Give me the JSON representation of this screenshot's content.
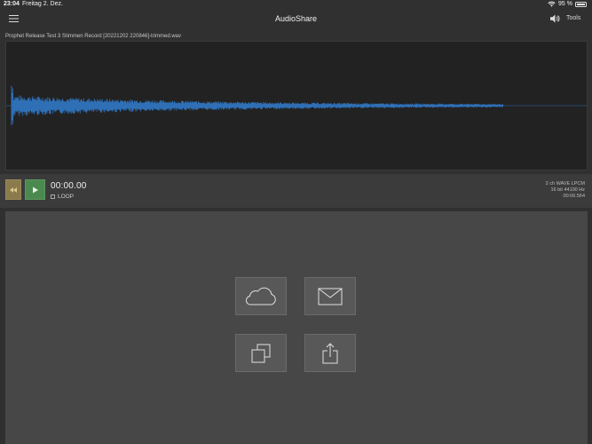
{
  "status_bar": {
    "time": "23:04",
    "date": "Freitag 2. Dez.",
    "battery": "95 %",
    "battery_level": 0.95
  },
  "nav": {
    "title": "AudioShare",
    "tools_label": "Tools"
  },
  "file": {
    "name": "Prophet Release Test 3 Stimmen Record [20221202 220846]-trimmed.wav"
  },
  "transport": {
    "time": "00:00.00",
    "loop_label": "LOOP"
  },
  "file_info": {
    "format": "2 ch WAVE LPCM",
    "rate": "16 bit 44100 Hz",
    "duration": "00:06.564"
  },
  "icons": {
    "menu": "hamburger-icon",
    "speaker": "speaker-icon",
    "rewind": "rewind-icon",
    "play": "play-icon",
    "cloud": "cloud-icon",
    "mail": "mail-icon",
    "copy": "copy-icon",
    "share": "share-icon"
  },
  "colors": {
    "waveform": "#2f6fb5",
    "play_button": "#4b8a4f",
    "rewind_button": "#8a7a4c"
  }
}
